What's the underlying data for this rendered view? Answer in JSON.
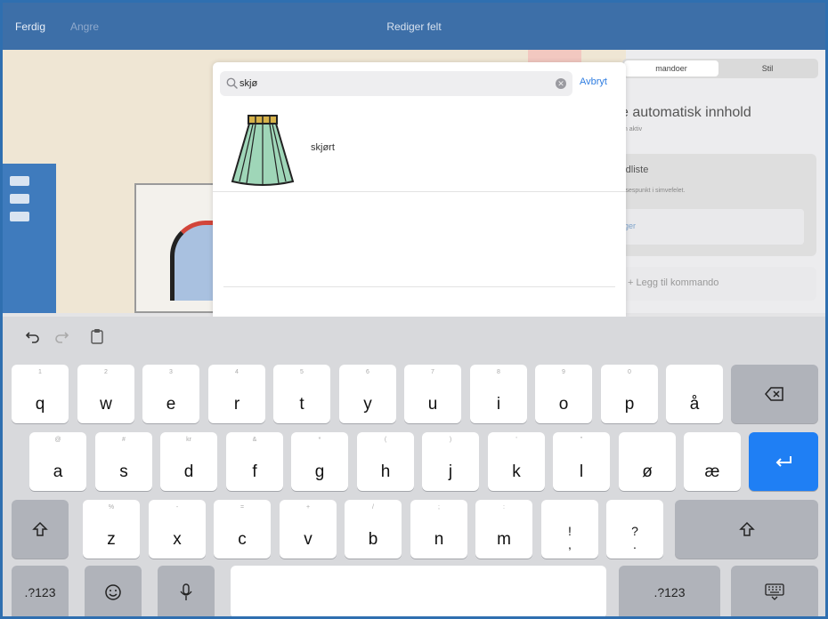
{
  "nav": {
    "done": "Ferdig",
    "undo": "Angre",
    "title": "Rediger felt"
  },
  "settings": {
    "segment_left": "mandoer",
    "segment_right": "Stil",
    "heading": "e automatisk innhold",
    "heading_sub": "m aktiv",
    "card_title": "rdliste",
    "card_sub": "Ilsespunkt i simvefelet.",
    "card_link": "ger",
    "add_command": "+ Legg til kommando"
  },
  "search": {
    "value": "skjø",
    "cancel": "Avbryt"
  },
  "results": [
    {
      "label": "skjørt",
      "icon": "skirt-symbol"
    }
  ],
  "keyboard": {
    "row1": [
      {
        "hint": "1",
        "key": "q"
      },
      {
        "hint": "2",
        "key": "w"
      },
      {
        "hint": "3",
        "key": "e"
      },
      {
        "hint": "4",
        "key": "r"
      },
      {
        "hint": "5",
        "key": "t"
      },
      {
        "hint": "6",
        "key": "y"
      },
      {
        "hint": "7",
        "key": "u"
      },
      {
        "hint": "8",
        "key": "i"
      },
      {
        "hint": "9",
        "key": "o"
      },
      {
        "hint": "0",
        "key": "p"
      },
      {
        "hint": "",
        "key": "å"
      }
    ],
    "row2": [
      {
        "hint": "@",
        "key": "a"
      },
      {
        "hint": "#",
        "key": "s"
      },
      {
        "hint": "kr",
        "key": "d"
      },
      {
        "hint": "&",
        "key": "f"
      },
      {
        "hint": "*",
        "key": "g"
      },
      {
        "hint": "(",
        "key": "h"
      },
      {
        "hint": ")",
        "key": "j"
      },
      {
        "hint": "'",
        "key": "k"
      },
      {
        "hint": "\"",
        "key": "l"
      },
      {
        "hint": "",
        "key": "ø"
      },
      {
        "hint": "",
        "key": "æ"
      }
    ],
    "row3": [
      {
        "hint": "%",
        "key": "z"
      },
      {
        "hint": "-",
        "key": "x"
      },
      {
        "hint": "=",
        "key": "c"
      },
      {
        "hint": "+",
        "key": "v"
      },
      {
        "hint": "/",
        "key": "b"
      },
      {
        "hint": ";",
        "key": "n"
      },
      {
        "hint": ":",
        "key": "m"
      },
      {
        "hint": "",
        "key": "!\n,"
      },
      {
        "hint": "",
        "key": "?\n."
      }
    ],
    "numbers_left": ".?123",
    "numbers_right": ".?123"
  },
  "colors": {
    "nav_bar": "#3d6fa8",
    "accent": "#2f7de1",
    "return_key": "#1f7ff4"
  }
}
